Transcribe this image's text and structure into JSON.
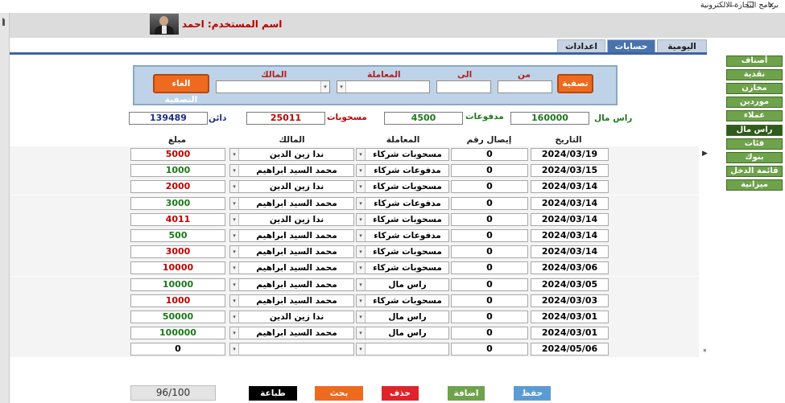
{
  "window": {
    "title": "برنامج التجارة الالكترونية",
    "minimize": "—",
    "restore": "❐",
    "close": "✕"
  },
  "header": {
    "user_label": "اسم المستخدم: احمد"
  },
  "tabs": [
    {
      "label": "اليومية",
      "active": false
    },
    {
      "label": "حسابات",
      "active": true
    },
    {
      "label": "اعدادات",
      "active": false
    }
  ],
  "nav": [
    {
      "label": "أصناف",
      "active": false
    },
    {
      "label": "نقدية",
      "active": false
    },
    {
      "label": "مخازن",
      "active": false
    },
    {
      "label": "موردين",
      "active": false
    },
    {
      "label": "عملاء",
      "active": false
    },
    {
      "label": "راس مال",
      "active": true
    },
    {
      "label": "فئات",
      "active": false
    },
    {
      "label": "بنوك",
      "active": false
    },
    {
      "label": "قائمة الدخل",
      "active": false
    },
    {
      "label": "ميزانية",
      "active": false
    }
  ],
  "filter": {
    "from_label": "من",
    "to_label": "الى",
    "transaction_label": "المعاملة",
    "owner_label": "المالك",
    "from_value": "",
    "to_value": "",
    "transaction_value": "",
    "owner_value": "",
    "filter_button": "تصفية",
    "clear_button": "الغاء التصفية"
  },
  "summary": {
    "capital_label": "راس مال",
    "capital_value": "160000",
    "payments_label": "مدفوعات",
    "payments_value": "4500",
    "withdrawals_label": "مسحوبات",
    "withdrawals_value": "25011",
    "creditor_label": "دائن",
    "creditor_value": "139489"
  },
  "table": {
    "headers": {
      "date": "التاريخ",
      "receipt": "إيصال رقم",
      "transaction": "المعاملة",
      "owner": "المالك",
      "amount": "مبلغ"
    },
    "rows": [
      {
        "date": "2024/03/19",
        "receipt": "0",
        "transaction": "مسحوبات شركاء",
        "owner": "ندا زين الدين",
        "amount": "5000",
        "amount_color": "red"
      },
      {
        "date": "2024/03/15",
        "receipt": "0",
        "transaction": "مدفوعات شركاء",
        "owner": "محمد السيد ابراهيم",
        "amount": "1000",
        "amount_color": "green"
      },
      {
        "date": "2024/03/14",
        "receipt": "0",
        "transaction": "مسحوبات شركاء",
        "owner": "ندا زين الدين",
        "amount": "2000",
        "amount_color": "red"
      },
      {
        "date": "2024/03/14",
        "receipt": "0",
        "transaction": "مدفوعات شركاء",
        "owner": "محمد السيد ابراهيم",
        "amount": "3000",
        "amount_color": "green"
      },
      {
        "date": "2024/03/14",
        "receipt": "0",
        "transaction": "مسحوبات شركاء",
        "owner": "ندا زين الدين",
        "amount": "4011",
        "amount_color": "red"
      },
      {
        "date": "2024/03/14",
        "receipt": "0",
        "transaction": "مدفوعات شركاء",
        "owner": "محمد السيد ابراهيم",
        "amount": "500",
        "amount_color": "green"
      },
      {
        "date": "2024/03/14",
        "receipt": "0",
        "transaction": "مسحوبات شركاء",
        "owner": "محمد السيد ابراهيم",
        "amount": "3000",
        "amount_color": "red"
      },
      {
        "date": "2024/03/06",
        "receipt": "0",
        "transaction": "مسحوبات شركاء",
        "owner": "محمد السيد ابراهيم",
        "amount": "10000",
        "amount_color": "red"
      },
      {
        "date": "2024/03/05",
        "receipt": "0",
        "transaction": "راس مال",
        "owner": "محمد السيد ابراهيم",
        "amount": "10000",
        "amount_color": "green"
      },
      {
        "date": "2024/03/03",
        "receipt": "0",
        "transaction": "مسحوبات شركاء",
        "owner": "محمد السيد ابراهيم",
        "amount": "1000",
        "amount_color": "red"
      },
      {
        "date": "2024/03/01",
        "receipt": "0",
        "transaction": "راس مال",
        "owner": "ندا زين الدين",
        "amount": "50000",
        "amount_color": "green"
      },
      {
        "date": "2024/03/01",
        "receipt": "0",
        "transaction": "راس مال",
        "owner": "محمد السيد ابراهيم",
        "amount": "100000",
        "amount_color": "green"
      },
      {
        "date": "2024/05/06",
        "receipt": "0",
        "transaction": "",
        "owner": "",
        "amount": "0",
        "amount_color": "black"
      }
    ]
  },
  "bottom": {
    "page_counter": "96/100",
    "print": "طباعة",
    "search": "بحث",
    "delete": "حذف",
    "add": "اضافة",
    "save": "حفظ"
  },
  "colors": {
    "print": "#000000",
    "search": "#ee6a1e",
    "delete": "#e0232a",
    "add": "#6ea24b",
    "save": "#5b9bd5"
  },
  "markers": {
    "current_row": "▶",
    "new_row": "*"
  }
}
